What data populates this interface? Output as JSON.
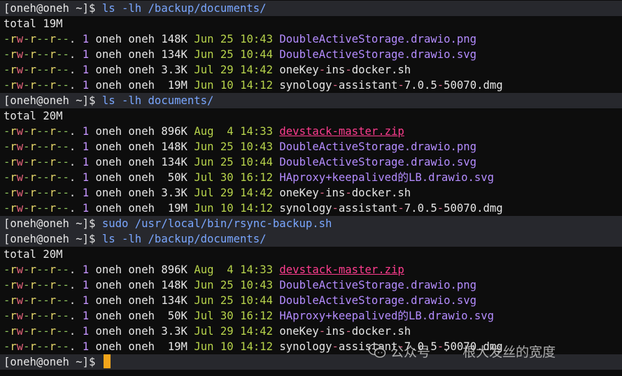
{
  "prompt": "[oneh@oneh ~]$ ",
  "blocks": [
    {
      "command": "ls -lh /backup/documents/",
      "total": "total 19M",
      "rows": [
        {
          "perm": "-rw-r--r--.",
          "links": "1",
          "owner": "oneh",
          "group": "oneh",
          "size": "148K",
          "month": "Jun",
          "day": "25",
          "time": "10:43",
          "name": "DoubleActiveStorage.drawio.png",
          "kind": "img"
        },
        {
          "perm": "-rw-r--r--.",
          "links": "1",
          "owner": "oneh",
          "group": "oneh",
          "size": "134K",
          "month": "Jun",
          "day": "25",
          "time": "10:44",
          "name": "DoubleActiveStorage.drawio.svg",
          "kind": "img"
        },
        {
          "perm": "-rw-r--r--.",
          "links": "1",
          "owner": "oneh",
          "group": "oneh",
          "size": "3.3K",
          "month": "Jul",
          "day": "29",
          "time": "14:42",
          "name": "oneKey-ins-docker.sh",
          "kind": "plain"
        },
        {
          "perm": "-rw-r--r--.",
          "links": "1",
          "owner": "oneh",
          "group": "oneh",
          "size": " 19M",
          "month": "Jun",
          "day": "10",
          "time": "14:12",
          "name": "synology-assistant-7.0.5-50070.dmg",
          "kind": "plain"
        }
      ]
    },
    {
      "command": "ls -lh documents/",
      "total": "total 20M",
      "rows": [
        {
          "perm": "-rw-r--r--.",
          "links": "1",
          "owner": "oneh",
          "group": "oneh",
          "size": "896K",
          "month": "Aug",
          "day": " 4",
          "time": "14:33",
          "name": "devstack-master.zip",
          "kind": "zip"
        },
        {
          "perm": "-rw-r--r--.",
          "links": "1",
          "owner": "oneh",
          "group": "oneh",
          "size": "148K",
          "month": "Jun",
          "day": "25",
          "time": "10:43",
          "name": "DoubleActiveStorage.drawio.png",
          "kind": "img"
        },
        {
          "perm": "-rw-r--r--.",
          "links": "1",
          "owner": "oneh",
          "group": "oneh",
          "size": "134K",
          "month": "Jun",
          "day": "25",
          "time": "10:44",
          "name": "DoubleActiveStorage.drawio.svg",
          "kind": "img"
        },
        {
          "perm": "-rw-r--r--.",
          "links": "1",
          "owner": "oneh",
          "group": "oneh",
          "size": " 50K",
          "month": "Jul",
          "day": "30",
          "time": "16:12",
          "name": "HAproxy+keepalived的LB.drawio.svg",
          "kind": "img"
        },
        {
          "perm": "-rw-r--r--.",
          "links": "1",
          "owner": "oneh",
          "group": "oneh",
          "size": "3.3K",
          "month": "Jul",
          "day": "29",
          "time": "14:42",
          "name": "oneKey-ins-docker.sh",
          "kind": "plain"
        },
        {
          "perm": "-rw-r--r--.",
          "links": "1",
          "owner": "oneh",
          "group": "oneh",
          "size": " 19M",
          "month": "Jun",
          "day": "10",
          "time": "14:12",
          "name": "synology-assistant-7.0.5-50070.dmg",
          "kind": "plain"
        }
      ]
    },
    {
      "command": "sudo /usr/local/bin/rsync-backup.sh",
      "total": null,
      "rows": []
    },
    {
      "command": "ls -lh /backup/documents/",
      "total": "total 20M",
      "rows": [
        {
          "perm": "-rw-r--r--.",
          "links": "1",
          "owner": "oneh",
          "group": "oneh",
          "size": "896K",
          "month": "Aug",
          "day": " 4",
          "time": "14:33",
          "name": "devstack-master.zip",
          "kind": "zip"
        },
        {
          "perm": "-rw-r--r--.",
          "links": "1",
          "owner": "oneh",
          "group": "oneh",
          "size": "148K",
          "month": "Jun",
          "day": "25",
          "time": "10:43",
          "name": "DoubleActiveStorage.drawio.png",
          "kind": "img"
        },
        {
          "perm": "-rw-r--r--.",
          "links": "1",
          "owner": "oneh",
          "group": "oneh",
          "size": "134K",
          "month": "Jun",
          "day": "25",
          "time": "10:44",
          "name": "DoubleActiveStorage.drawio.svg",
          "kind": "img"
        },
        {
          "perm": "-rw-r--r--.",
          "links": "1",
          "owner": "oneh",
          "group": "oneh",
          "size": " 50K",
          "month": "Jul",
          "day": "30",
          "time": "16:12",
          "name": "HAproxy+keepalived的LB.drawio.svg",
          "kind": "img"
        },
        {
          "perm": "-rw-r--r--.",
          "links": "1",
          "owner": "oneh",
          "group": "oneh",
          "size": "3.3K",
          "month": "Jul",
          "day": "29",
          "time": "14:42",
          "name": "oneKey-ins-docker.sh",
          "kind": "plain"
        },
        {
          "perm": "-rw-r--r--.",
          "links": "1",
          "owner": "oneh",
          "group": "oneh",
          "size": " 19M",
          "month": "Jun",
          "day": "10",
          "time": "14:12",
          "name": "synology-assistant-7.0.5-50070.dmg",
          "kind": "plain"
        }
      ]
    }
  ],
  "final_prompt": "[oneh@oneh ~]$ ",
  "watermark": {
    "icon": "wechat-icon",
    "account_label": "公众号",
    "separator": "·",
    "author": "根大发丝的宽度"
  }
}
